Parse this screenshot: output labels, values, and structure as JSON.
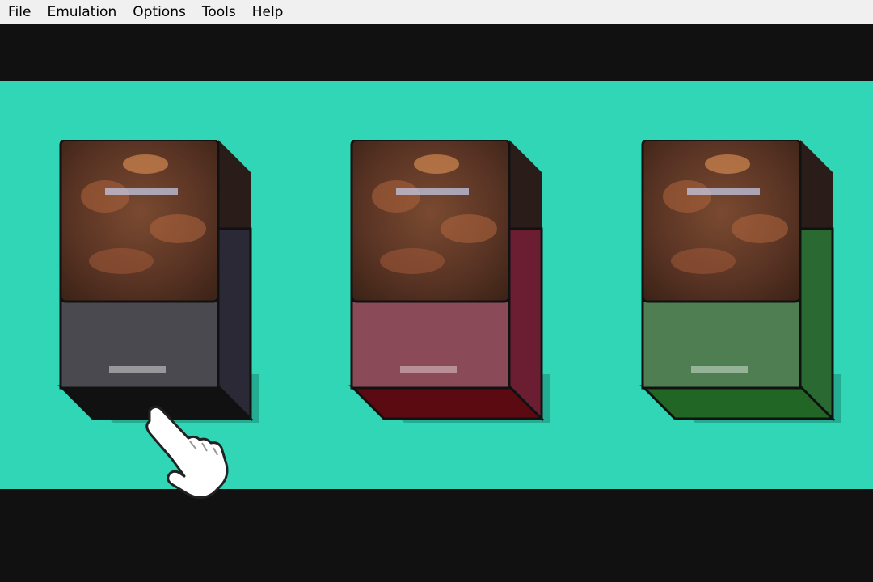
{
  "menubar": {
    "items": [
      "File",
      "Emulation",
      "Options",
      "Tools",
      "Help"
    ]
  },
  "game": {
    "stage_color": "#30d6b6",
    "decks": [
      {
        "id": "deck-1",
        "color_name": "black",
        "front": "#4a494f",
        "side": "#2a2935",
        "bottom": "#111111",
        "selected": true
      },
      {
        "id": "deck-2",
        "color_name": "red",
        "front": "#8a4a58",
        "side": "#6b1e32",
        "bottom": "#5a0a10",
        "selected": false
      },
      {
        "id": "deck-3",
        "color_name": "green",
        "front": "#4e7e52",
        "side": "#2a6a32",
        "bottom": "#226626",
        "selected": false
      }
    ],
    "cursor_icon": "pointing-hand-icon"
  }
}
